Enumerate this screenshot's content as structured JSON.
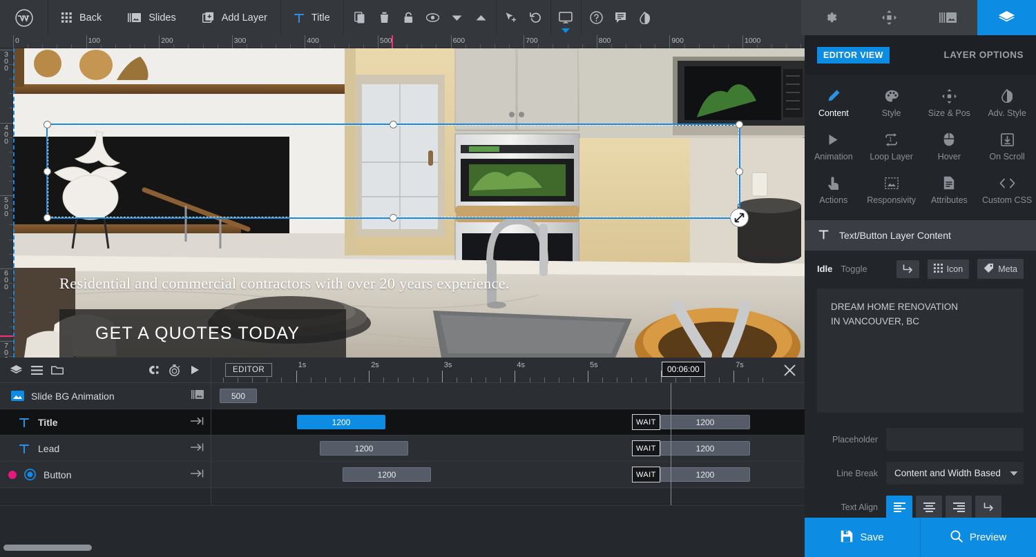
{
  "topbar": {
    "logo_icon": "wordpress-icon",
    "nav": [
      {
        "label": "Back",
        "icon": "grid-icon"
      },
      {
        "label": "Slides",
        "icon": "slides-icon"
      },
      {
        "label": "Add Layer",
        "icon": "add-layer-icon"
      }
    ],
    "current_layer": {
      "label": "Title",
      "icon": "text-layer-icon"
    },
    "tool_icons": [
      "copy-icon",
      "trash-icon",
      "lock-icon",
      "eye-icon",
      "chevron-down-icon",
      "chevron-up-icon",
      "cursor-add-icon",
      "undo-icon",
      "desktop-icon",
      "help-icon",
      "comment-icon",
      "contrast-icon"
    ],
    "right_icons": [
      "gear-icon",
      "move-icon",
      "navigation-icon",
      "layers-icon"
    ]
  },
  "canvas": {
    "ruler_top_labels": [
      "0",
      "100",
      "200",
      "300",
      "400",
      "500",
      "600",
      "700",
      "800",
      "900",
      "1000"
    ],
    "ruler_left_labels": [
      "300",
      "400",
      "500",
      "600",
      "700"
    ],
    "lead_text": "Residential and commercial contractors with over 20 years experience.",
    "button_text": "GET A QUOTES TODAY",
    "resize_cursor_icon": "resize-nwse-icon"
  },
  "timeline": {
    "toolbar_icons": [
      "layers-icon",
      "list-icon",
      "folder-icon",
      "clip-icon",
      "stopwatch-icon",
      "play-icon"
    ],
    "editor_chip": "EDITOR",
    "close_icon": "close-icon",
    "timecode": "00:06:00",
    "ruler_labels": [
      "1s",
      "2s",
      "3s",
      "4s",
      "5s",
      "7s"
    ],
    "rows": [
      {
        "name": "Slide BG Animation",
        "icon": "image-layer-icon",
        "right_icon": "gallery-icon",
        "bars": [
          {
            "label": "500",
            "start": 12,
            "width": 54,
            "style": "grey"
          }
        ]
      },
      {
        "name": "Title",
        "icon": "text-layer-icon",
        "right_icon": "end-arrow-icon",
        "selected": true,
        "bars": [
          {
            "label": "1200",
            "start": 124,
            "width": 128,
            "style": "blue"
          },
          {
            "label": "1200",
            "start": 641,
            "width": 139,
            "style": "grey",
            "wait": "WAIT"
          }
        ]
      },
      {
        "name": "Lead",
        "icon": "text-layer-icon",
        "right_icon": "end-arrow-icon",
        "bars": [
          {
            "label": "1200",
            "start": 157,
            "width": 128,
            "style": "grey"
          },
          {
            "label": "1200",
            "start": 641,
            "width": 139,
            "style": "grey",
            "wait": "WAIT"
          }
        ]
      },
      {
        "name": "Button",
        "icon": "button-layer-icon",
        "right_icon": "end-arrow-icon",
        "dot": "#e8197d",
        "bars": [
          {
            "label": "1200",
            "start": 190,
            "width": 128,
            "style": "grey"
          },
          {
            "label": "1200",
            "start": 641,
            "width": 139,
            "style": "grey",
            "wait": "WAIT"
          }
        ]
      }
    ]
  },
  "panel": {
    "header": {
      "view_chip": "EDITOR VIEW",
      "title": "LAYER OPTIONS"
    },
    "tabs": [
      {
        "label": "Content",
        "icon": "pencil-icon",
        "active": true
      },
      {
        "label": "Style",
        "icon": "palette-icon",
        "active": false
      },
      {
        "label": "Size & Pos",
        "icon": "move-icon",
        "active": false
      },
      {
        "label": "Adv. Style",
        "icon": "contrast-icon",
        "active": false
      },
      {
        "label": "Animation",
        "icon": "play-icon",
        "active": false
      },
      {
        "label": "Loop Layer",
        "icon": "loop-icon",
        "active": false
      },
      {
        "label": "Hover",
        "icon": "mouse-icon",
        "active": false
      },
      {
        "label": "On Scroll",
        "icon": "scroll-down-icon",
        "active": false
      },
      {
        "label": "Actions",
        "icon": "tap-icon",
        "active": false
      },
      {
        "label": "Responsivity",
        "icon": "responsive-icon",
        "active": false
      },
      {
        "label": "Attributes",
        "icon": "document-icon",
        "active": false
      },
      {
        "label": "Custom CSS",
        "icon": "code-icon",
        "active": false
      }
    ],
    "section": {
      "icon": "text-layer-icon",
      "title": "Text/Button Layer Content"
    },
    "state_toggles": [
      {
        "label": "Idle",
        "active": true
      },
      {
        "label": "Toggle",
        "active": false
      }
    ],
    "quick_buttons": [
      {
        "label": "",
        "icon": "return-arrow-icon"
      },
      {
        "label": "Icon",
        "icon": "grid-dots-icon"
      },
      {
        "label": "Meta",
        "icon": "tag-icon"
      }
    ],
    "content_text": "DREAM HOME RENOVATION\nIN VANCOUVER, BC",
    "fields": {
      "placeholder_label": "Placeholder",
      "placeholder_value": "",
      "line_break_label": "Line Break",
      "line_break_value": "Content and Width Based",
      "text_align_label": "Text Align",
      "text_align_options": [
        "align-left-icon",
        "align-center-icon",
        "align-right-icon",
        "align-return-icon"
      ],
      "text_align_selected": 0
    },
    "footer": [
      {
        "label": "Save",
        "icon": "save-icon"
      },
      {
        "label": "Preview",
        "icon": "search-icon"
      }
    ]
  },
  "colors": {
    "accent": "#0d8ce4",
    "panel_bg": "#22262a",
    "topbar_bg": "#34383c",
    "pink": "#ff2d78"
  }
}
